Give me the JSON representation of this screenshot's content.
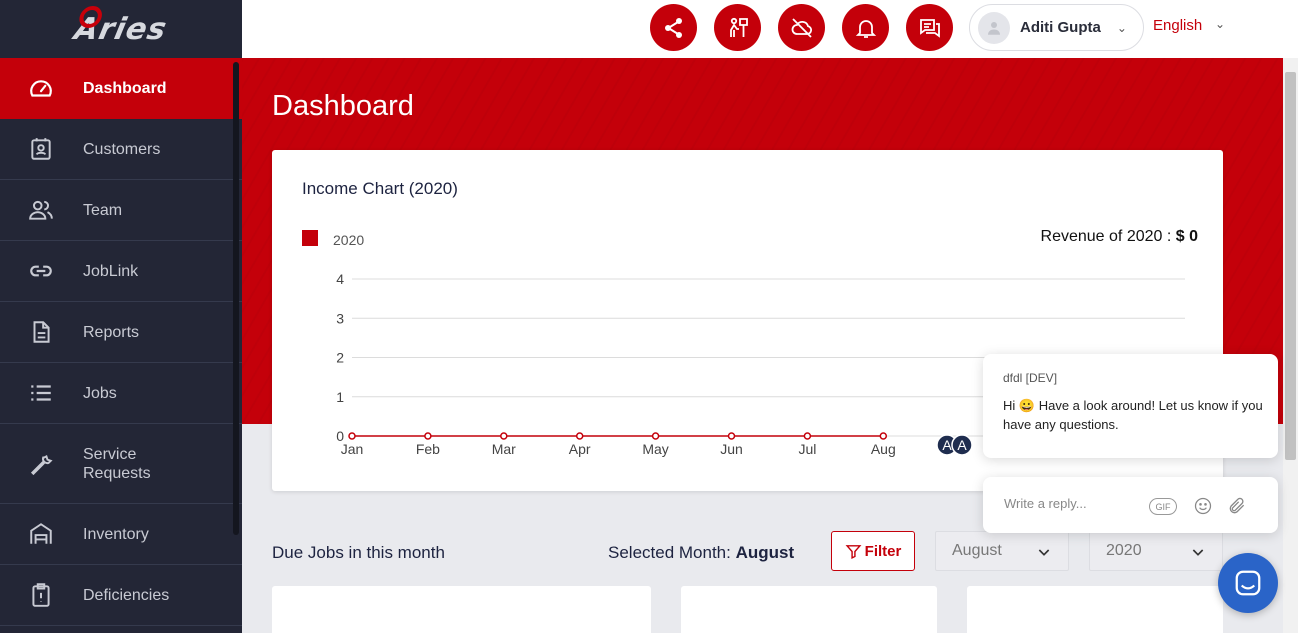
{
  "brand": {
    "logo_text": "Aries",
    "accent": "#c4000a",
    "sidebar_bg": "#232636"
  },
  "sidebar": {
    "items": [
      {
        "label": "Dashboard",
        "icon": "speedometer-icon",
        "active": true
      },
      {
        "label": "Customers",
        "icon": "contact-card-icon"
      },
      {
        "label": "Team",
        "icon": "people-icon"
      },
      {
        "label": "JobLink",
        "icon": "link-icon"
      },
      {
        "label": "Reports",
        "icon": "document-icon"
      },
      {
        "label": "Jobs",
        "icon": "list-icon"
      },
      {
        "label": "Service\nRequests",
        "icon": "wrench-icon"
      },
      {
        "label": "Inventory",
        "icon": "warehouse-icon"
      },
      {
        "label": "Deficiencies",
        "icon": "clipboard-alert-icon"
      }
    ]
  },
  "topbar": {
    "actions": [
      {
        "icon": "share-icon"
      },
      {
        "icon": "worker-icon"
      },
      {
        "icon": "cloud-off-icon"
      },
      {
        "icon": "bell-icon"
      },
      {
        "icon": "chat-icon"
      }
    ],
    "user_name": "Aditi Gupta",
    "language": "English"
  },
  "page": {
    "title": "Dashboard"
  },
  "income_chart": {
    "title": "Income Chart (2020)",
    "revenue_label": "Revenue of 2020 :",
    "revenue_value": "$ 0"
  },
  "chart_data": {
    "type": "line",
    "title": "Income Chart (2020)",
    "categories": [
      "Jan",
      "Feb",
      "Mar",
      "Apr",
      "May",
      "Jun",
      "Jul",
      "Aug"
    ],
    "series": [
      {
        "name": "2020",
        "values": [
          0,
          0,
          0,
          0,
          0,
          0,
          0,
          0
        ],
        "color": "#c4000a"
      }
    ],
    "yticks": [
      0,
      1,
      2,
      3,
      4
    ],
    "ylim": [
      0,
      4
    ],
    "grid": true,
    "legend": "top-left",
    "xlabel": "",
    "ylabel": ""
  },
  "overlay_avatars": [
    "A",
    "A"
  ],
  "due_jobs": {
    "title": "Due Jobs in this month",
    "selected_label": "Selected Month:",
    "selected_value": "August",
    "filter_label": "Filter",
    "month_select": "August",
    "year_select": "2020"
  },
  "chat": {
    "sender": "dfdl [DEV]",
    "message_pre": "Hi",
    "message_post": "Have a look around! Let us know if you have any questions.",
    "reply_placeholder": "Write a reply...",
    "gif_label": "GIF"
  }
}
